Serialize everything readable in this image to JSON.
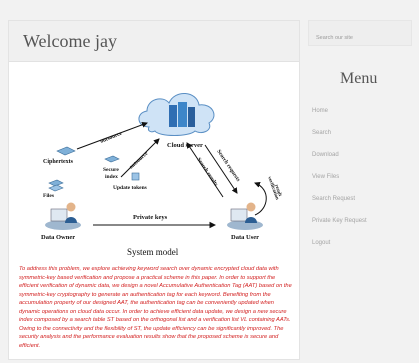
{
  "header": {
    "title": "Welcome jay"
  },
  "diagram": {
    "labels": {
      "outsource_left": "outsource",
      "outsource_mid": "outsource",
      "cloud_server": "Cloud server",
      "ciphertexts": "Ciphertexts",
      "secure": "Secure",
      "index": "index",
      "update_tokens": "Update tokens",
      "files": "Files",
      "search_requests": "Search requests",
      "search_results": "Search results",
      "result": "result",
      "verification": "verification",
      "data_owner": "Data Owner",
      "private_keys": "Private keys",
      "data_user": "Data User"
    },
    "caption": "System model"
  },
  "paragraph": "To address this problem, we explore achieving keyword search over dynamic encrypted cloud data with symmetric-key based verification and propose a practical scheme in this paper. In order to support the efficient verification of dynamic data, we design a novel Accumulative Authentication Tag (AAT) based on the symmetric-key cryptography to generate an authentication tag for each keyword. Benefiting from the accumulation property of our designed AAT, the authentication tag can be conveniently updated when dynamic operations on cloud data occur. In order to achieve efficient data update, we design a new secure index composed by a search table ST based on the orthogonal list and a verification list VL containing AATs. Owing to the connectivity and the flexibility of ST, the update efficiency can be significantly improved. The security analysis and the performance evaluation results show that the proposed scheme is secure and efficient.",
  "sidebar": {
    "search_placeholder": "Search our site",
    "menu_title": "Menu",
    "items": [
      {
        "label": "Home"
      },
      {
        "label": "Search"
      },
      {
        "label": "Download"
      },
      {
        "label": "View Files"
      },
      {
        "label": "Search Request"
      },
      {
        "label": "Private Key Request"
      },
      {
        "label": "Logout"
      }
    ]
  },
  "colors": {
    "paragraph_text": "#d21f1f",
    "menu_text": "#a4a4a4",
    "title_text": "#555555"
  }
}
